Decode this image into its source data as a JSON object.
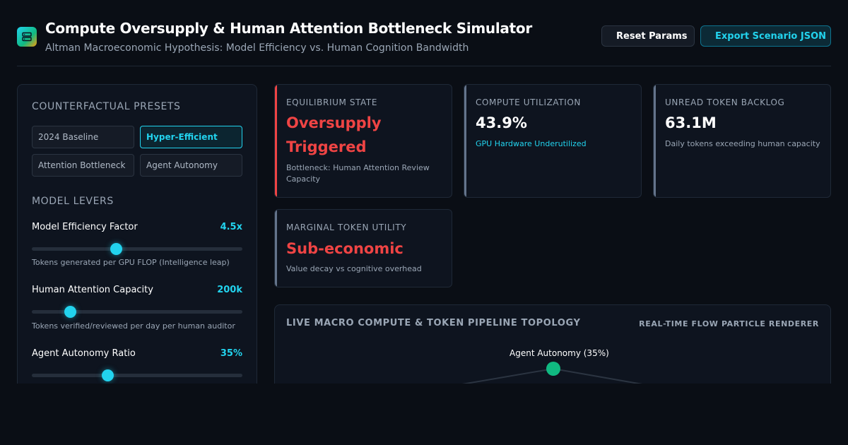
{
  "header": {
    "title": "Compute Oversupply & Human Attention Bottleneck Simulator",
    "subtitle": "Altman Macroeconomic Hypothesis: Model Efficiency vs. Human Cognition Bandwidth",
    "logo_icon": "server-stack-icon",
    "reset_label": "Reset Params",
    "export_label": "Export Scenario JSON"
  },
  "presets": {
    "title": "COUNTERFACTUAL PRESETS",
    "items": [
      {
        "label": "2024 Baseline",
        "active": false
      },
      {
        "label": "Hyper-Efficient",
        "active": true
      },
      {
        "label": "Attention Bottleneck",
        "active": false
      },
      {
        "label": "Agent Autonomy",
        "active": false
      }
    ]
  },
  "levers": {
    "title": "MODEL LEVERS",
    "items": [
      {
        "label": "Model Efficiency Factor",
        "value": "4.5x",
        "hint": "Tokens generated per GPU FLOP (Intelligence leap)",
        "fraction": 0.4
      },
      {
        "label": "Human Attention Capacity",
        "value": "200k",
        "hint": "Tokens verified/reviewed per day per human auditor",
        "fraction": 0.18
      },
      {
        "label": "Agent Autonomy Ratio",
        "value": "35%",
        "hint": "",
        "fraction": 0.36
      }
    ]
  },
  "kpis": {
    "equilibrium": {
      "label": "EQUILIBRIUM STATE",
      "value": "Oversupply Triggered",
      "sub": "Bottleneck: Human Attention Review Capacity"
    },
    "utilization": {
      "label": "COMPUTE UTILIZATION",
      "value": "43.9%",
      "sub": "GPU Hardware Underutilized"
    },
    "backlog": {
      "label": "UNREAD TOKEN BACKLOG",
      "value": "63.1M",
      "sub": "Daily tokens exceeding human capacity"
    },
    "utility": {
      "label": "MARGINAL TOKEN UTILITY",
      "value": "Sub-economic",
      "sub": "Value decay vs cognitive overhead"
    }
  },
  "topology": {
    "title": "LIVE MACRO COMPUTE & TOKEN PIPELINE TOPOLOGY",
    "badge": "REAL-TIME FLOW PARTICLE RENDERER",
    "node_label": "Agent Autonomy (35%)"
  },
  "colors": {
    "accent": "#22d3ee",
    "danger": "#ef4444",
    "success": "#10b981",
    "background": "#0a0e15"
  }
}
